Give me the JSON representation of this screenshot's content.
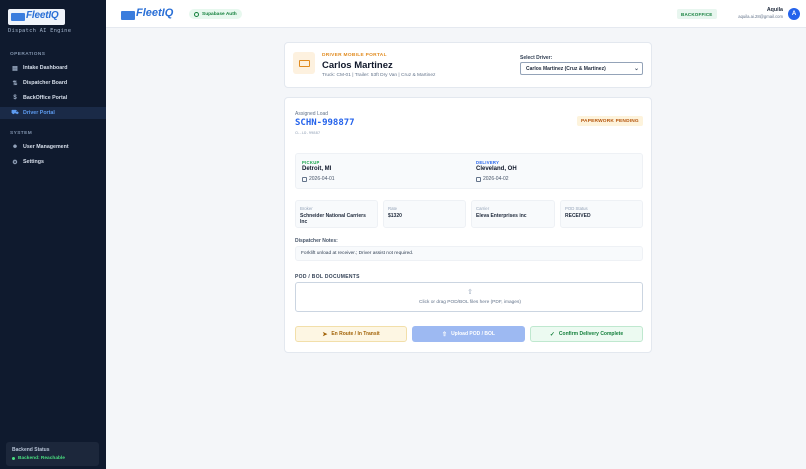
{
  "sidebar": {
    "logo_text": "FleetIQ",
    "engine_subtitle": "Dispatch AI Engine",
    "section_operations": "OPERATIONS",
    "section_system": "SYSTEM",
    "items": [
      {
        "label": "Intake Dashboard",
        "icon": "file-icon"
      },
      {
        "label": "Dispatcher Board",
        "icon": "route-icon"
      },
      {
        "label": "BackOffice Portal",
        "icon": "dollar-icon"
      },
      {
        "label": "Driver Portal",
        "icon": "truck-icon",
        "active": true
      },
      {
        "label": "User Management",
        "icon": "user-icon"
      },
      {
        "label": "Settings",
        "icon": "gear-icon"
      }
    ],
    "backend_title": "Backend Status",
    "backend_status": "Backend: Reachable"
  },
  "header": {
    "logo_text": "FleetIQ",
    "auth_badge": "Supabase Auth",
    "role_badge": "BACKOFFICE",
    "user_name": "Aquila",
    "user_email": "aquila.ai.28@gmail.com",
    "avatar_letter": "A"
  },
  "driver_card": {
    "portal_label": "DRIVER MOBILE PORTAL",
    "driver_name": "Carlos Martinez",
    "truck_info": "Truck: CM-01 | Trailer: 53ft Dry Van | Cruz & Martinez",
    "select_label": "Select Driver:",
    "select_value": "Carlos Martinez (Cruz & Martinez)"
  },
  "load": {
    "assigned_label": "Assigned Load",
    "load_id": "SCHN-998877",
    "load_ref": "CL-LD-99887",
    "status_badge": "PAPERWORK PENDING",
    "pickup_label": "PICKUP",
    "pickup_city": "Detroit, MI",
    "pickup_date": "2026-04-01",
    "delivery_label": "DELIVERY",
    "delivery_city": "Cleveland, OH",
    "delivery_date": "2026-04-02",
    "broker_label": "Broker",
    "broker_value": "Schneider National Carriers Inc",
    "rate_label": "Rate",
    "rate_value": "$1320",
    "carrier_label": "Carrier",
    "carrier_value": "Eleva Enterprises inc",
    "pod_label": "POD Status",
    "pod_value": "RECEIVED",
    "notes_label": "Dispatcher Notes:",
    "notes_text": "Forklift unload at receiver.; Driver assist not required.",
    "docs_label": "POD / BOL DOCUMENTS",
    "drop_text": "Click or drag POD/BOL files here (PDF, images)"
  },
  "actions": {
    "en_route": "En Route / In Transit",
    "upload": "Upload POD / BOL",
    "confirm": "Confirm Delivery Complete"
  },
  "colors": {
    "sidebar_bg": "#0f1a2e",
    "accent": "#2563eb",
    "portal_orange": "#e08a1e",
    "success": "#15803d"
  }
}
